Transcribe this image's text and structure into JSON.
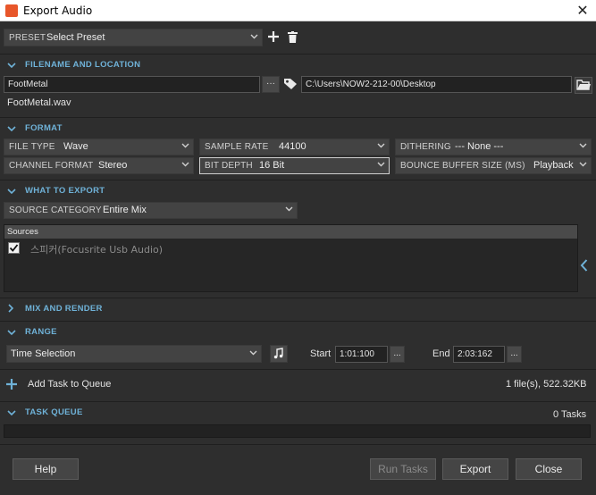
{
  "window": {
    "title": "Export Audio",
    "close_glyph": "✕"
  },
  "preset": {
    "label": "PRESET",
    "value": "Select Preset"
  },
  "filename_section": {
    "header": "FILENAME AND LOCATION",
    "filename": "FootMetal",
    "path": "C:\\Users\\NOW2-212-00\\Desktop",
    "browse_label": "···",
    "result_filename": "FootMetal.wav"
  },
  "format_section": {
    "header": "FORMAT",
    "file_type": {
      "label": "FILE TYPE",
      "value": "Wave"
    },
    "sample_rate": {
      "label": "SAMPLE RATE",
      "value": "44100"
    },
    "dithering": {
      "label": "DITHERING",
      "value": "--- None ---"
    },
    "channel_format": {
      "label": "CHANNEL FORMAT",
      "value": "Stereo"
    },
    "bit_depth": {
      "label": "BIT DEPTH",
      "value": "16 Bit"
    },
    "bounce_buffer": {
      "label": "BOUNCE BUFFER SIZE (MS)",
      "value": "Playback"
    }
  },
  "what_to_export": {
    "header": "WHAT TO EXPORT",
    "source_category": {
      "label": "SOURCE CATEGORY",
      "value": "Entire Mix"
    },
    "sources_header": "Sources",
    "sources": [
      {
        "label": "스피커(Focusrite Usb Audio)",
        "checked": true
      }
    ]
  },
  "mix_render": {
    "header": "MIX AND RENDER"
  },
  "range": {
    "header": "RANGE",
    "mode": "Time Selection",
    "start_label": "Start",
    "start_value": "1:01:100",
    "end_label": "End",
    "end_value": "2:03:162",
    "ellipsis": "..."
  },
  "queue": {
    "add_label": "Add Task to Queue",
    "summary": "1 file(s), 522.32KB",
    "header": "TASK QUEUE",
    "tasks_count": "0 Tasks"
  },
  "buttons": {
    "help": "Help",
    "run_tasks": "Run Tasks",
    "export": "Export",
    "close": "Close"
  },
  "colors": {
    "accent": "#6fb2d8",
    "background": "#2e2e2e",
    "control": "#434343",
    "app_icon": "#e8562a"
  }
}
